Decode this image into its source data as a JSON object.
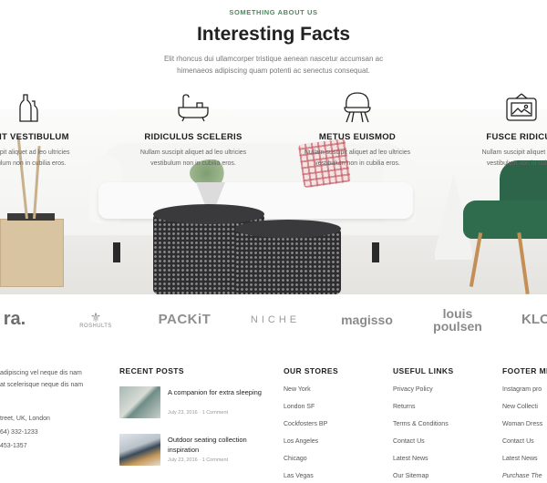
{
  "facts_section": {
    "kicker": "SOMETHING ABOUT US",
    "heading": "Interesting Facts",
    "intro_line1": "Elit rhoncus dui ullamcorper tristique aenean nascetur accumsan ac",
    "intro_line2": "himenaeos adipiscing quam potenti ac senectus consequat.",
    "items": [
      {
        "icon": "bottles-icon",
        "title": "ENT VESTIBULUM",
        "text_line1": "uscipit aliquet ad leo ultricies",
        "text_line2": "ibulum non in cubilia eros."
      },
      {
        "icon": "bathtub-icon",
        "title": "RIDICULUS SCELERIS",
        "text_line1": "Nullam  suscipit aliquet ad leo ultricies",
        "text_line2": "vestibulum non in cubilia eros."
      },
      {
        "icon": "armchair-icon",
        "title": "METUS EUISMOD",
        "text_line1": "Nullam  suscipit aliquet ad leo ultricies",
        "text_line2": "vestibulum non in cubilia eros."
      },
      {
        "icon": "picture-frame-icon",
        "title": "FUSCE RIDICUL",
        "text_line1": "Nullam  suscipit aliquet ad le",
        "text_line2": "vestibulum non in cubilia"
      }
    ]
  },
  "brands": [
    "ra.",
    "ROSHULTS",
    "PACKiT",
    "NICHE",
    "magisso",
    "louis",
    "poulsen",
    "KLO"
  ],
  "footer": {
    "about": {
      "lines": [
        "adipiscing vel neque dis nam",
        "at scelerisque neque dis nam"
      ],
      "address": "treet, UK, London",
      "phone1": "64) 332-1233",
      "phone2": "453-1357"
    },
    "recent_posts": {
      "title": "RECENT POSTS",
      "posts": [
        {
          "title": "A companion for extra sleeping",
          "date": "July 23, 2016",
          "comments": "1 Comment"
        },
        {
          "title": "Outdoor seating collection inspiration",
          "date": "July 23, 2016",
          "comments": "1 Comment"
        }
      ]
    },
    "our_stores": {
      "title": "OUR STORES",
      "links": [
        "New York",
        "London SF",
        "Cockfosters BP",
        "Los Angeles",
        "Chicago",
        "Las Vegas"
      ]
    },
    "useful_links": {
      "title": "USEFUL LINKS",
      "links": [
        "Privacy Policy",
        "Returns",
        "Terms & Conditions",
        "Contact Us",
        "Latest News",
        "Our Sitemap"
      ]
    },
    "footer_menu": {
      "title": "FOOTER ME",
      "links": [
        "Instagram pro",
        "New Collecti",
        "Woman Dress",
        "Contact Us",
        "Latest News",
        "Purchase The"
      ]
    }
  },
  "colors": {
    "accent_green": "#4b8a5c",
    "heading": "#222222",
    "muted_text": "#777777"
  }
}
